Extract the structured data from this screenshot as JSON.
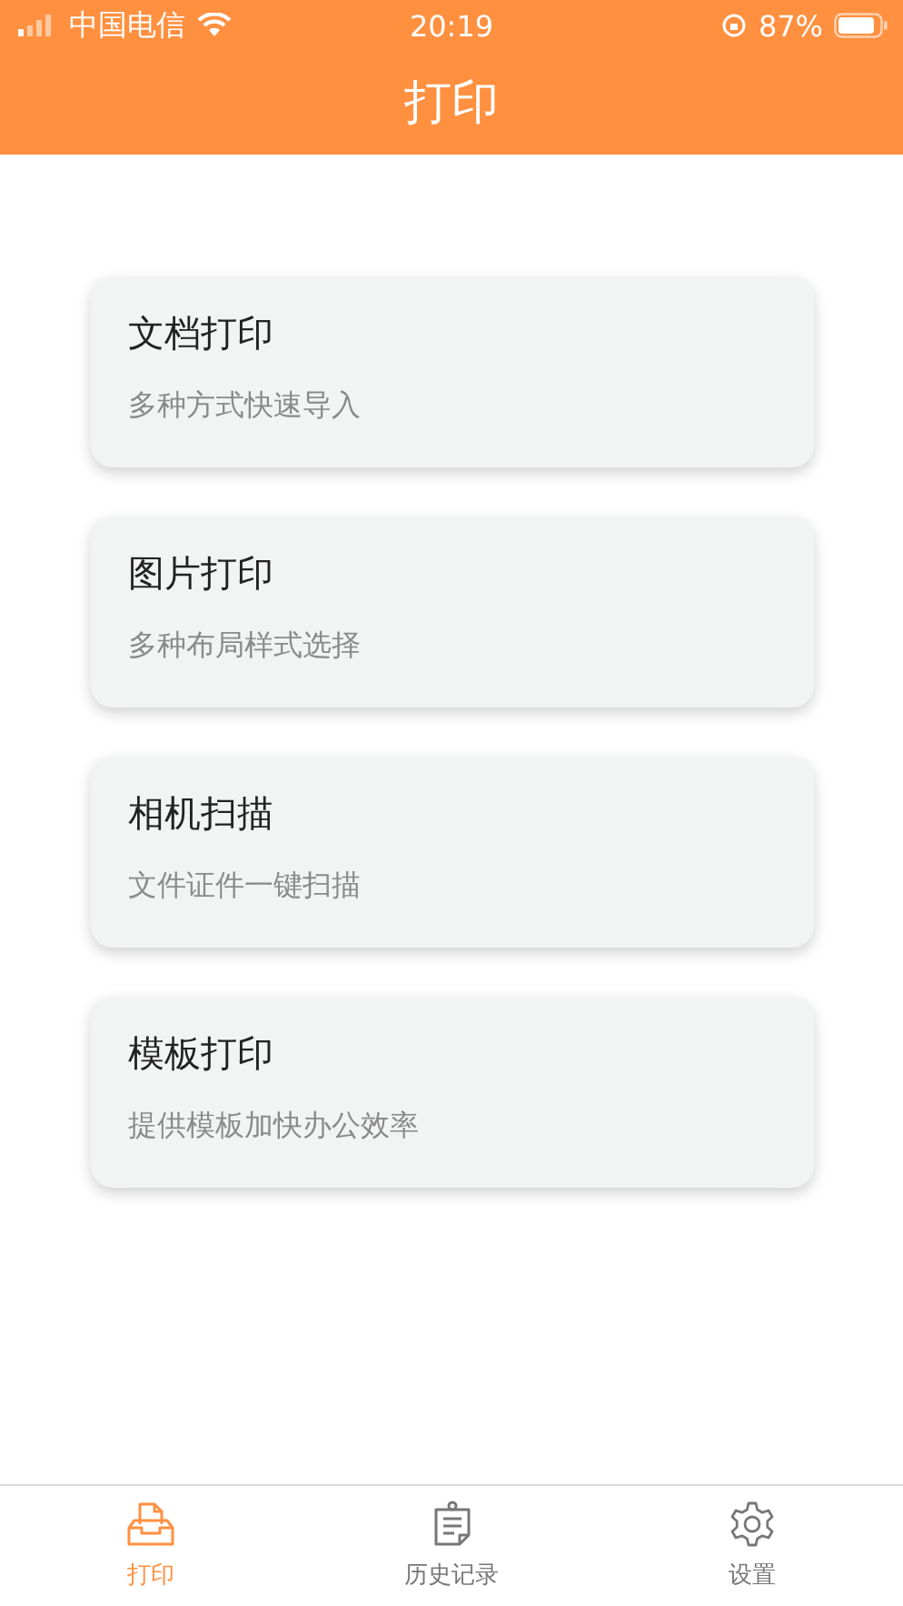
{
  "status_bar": {
    "carrier": "中国电信",
    "time": "20:19",
    "battery": "87%"
  },
  "header": {
    "title": "打印"
  },
  "cards": [
    {
      "title": "文档打印",
      "subtitle": "多种方式快速导入"
    },
    {
      "title": "图片打印",
      "subtitle": "多种布局样式选择"
    },
    {
      "title": "相机扫描",
      "subtitle": "文件证件一键扫描"
    },
    {
      "title": "模板打印",
      "subtitle": "提供模板加快办公效率"
    }
  ],
  "tab_bar": [
    {
      "label": "打印",
      "kind": "print",
      "selected": true
    },
    {
      "label": "历史记录",
      "kind": "history",
      "selected": false
    },
    {
      "label": "设置",
      "kind": "settings",
      "selected": false
    }
  ]
}
